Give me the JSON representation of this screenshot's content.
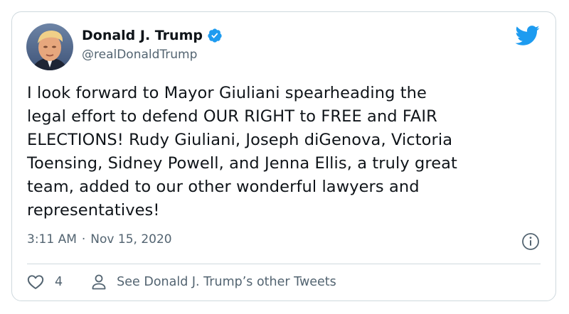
{
  "author": {
    "name": "Donald J. Trump",
    "handle": "@realDonaldTrump"
  },
  "icons": {
    "verified": "verified-badge-icon",
    "brand": "twitter-bird-icon",
    "info": "info-icon",
    "like": "heart-icon",
    "profile": "person-icon"
  },
  "colors": {
    "accent": "#1d9bf0",
    "text": "#0f1419",
    "secondary": "#536471",
    "border": "#cfd9de"
  },
  "tweet": {
    "text": "I look forward to Mayor Giuliani spearheading the\nlegal effort to defend OUR RIGHT to FREE and FAIR\nELECTIONS! Rudy Giuliani, Joseph diGenova, Victoria\nToensing, Sidney Powell, and Jenna Ellis, a truly great\nteam, added to our other wonderful lawyers and\nrepresentatives!",
    "time": "3:11 AM",
    "separator": "·",
    "date": "Nov 15, 2020"
  },
  "actions": {
    "like_count": "4",
    "other_tweets_label": "See Donald J. Trump’s other Tweets"
  }
}
